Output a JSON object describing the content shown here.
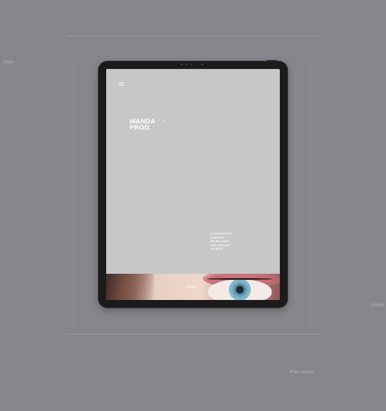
{
  "measurements": {
    "width_label": "768px",
    "height_label": "1024px"
  },
  "caption": "iPad version",
  "site": {
    "menu_icon": "hamburger-icon",
    "logo_line1": "WANDA",
    "logo_line2": "PROD.",
    "logo_registered": "®",
    "tagline_lines": [
      "A PRODUCTION",
      "COMPANY",
      "WE BALANCE",
      "AND SUPPORT",
      "TALENTS"
    ],
    "scroll_label": "SCROLL",
    "colors": {
      "background": "#85868b",
      "screen": "#c7c7c8",
      "text": "#ffffff",
      "device": "#1b1b1c"
    }
  }
}
